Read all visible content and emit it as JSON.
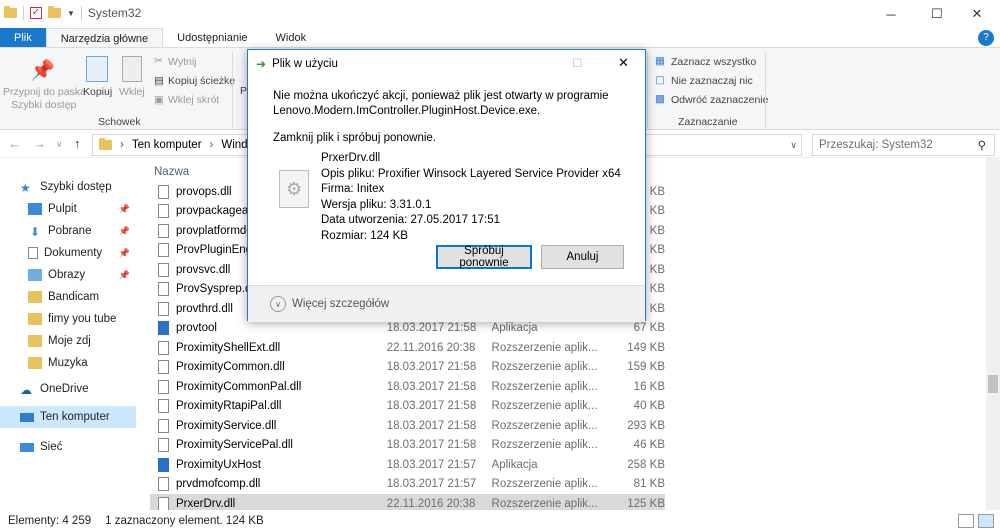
{
  "window": {
    "title": "System32",
    "controls": [
      "─",
      "☐",
      "✕"
    ]
  },
  "ribbon_tabs": [
    "Plik",
    "Narzędzia główne",
    "Udostępnianie",
    "Widok"
  ],
  "ribbon": {
    "pin_label_1": "Przypnij do paska",
    "pin_label_2": "Szybki dostęp",
    "copy": "Kopiuj",
    "paste": "Wklej",
    "cut": "Wytnij",
    "copy_path": "Kopiuj ścieżkę",
    "paste_shortcut": "Wklej skrót",
    "partial_p": "P",
    "group_clipboard": "Schowek",
    "select_all": "Zaznacz wszystko",
    "select_none": "Nie zaznaczaj nic",
    "invert": "Odwróć zaznaczenie",
    "group_select": "Zaznaczanie",
    "help": "?"
  },
  "address": {
    "parts": [
      "Ten komputer",
      "Window"
    ],
    "search_placeholder": "Przeszukaj: System32"
  },
  "nav": {
    "quick": "Szybki dostęp",
    "items": [
      "Pulpit",
      "Pobrane",
      "Dokumenty",
      "Obrazy",
      "Bandicam",
      "fimy you tube",
      "Moje zdj",
      "Muzyka"
    ],
    "onedrive": "OneDrive",
    "thispc": "Ten komputer",
    "network": "Sieć"
  },
  "list": {
    "header_name": "Nazwa",
    "rows": [
      {
        "name": "provops.dll",
        "date": "",
        "type": "",
        "size": "KB"
      },
      {
        "name": "provpackageap",
        "date": "",
        "type": "",
        "size": "KB"
      },
      {
        "name": "provplatformde",
        "date": "",
        "type": "",
        "size": "KB"
      },
      {
        "name": "ProvPluginEng.d",
        "date": "",
        "type": "",
        "size": "KB"
      },
      {
        "name": "provsvc.dll",
        "date": "",
        "type": "",
        "size": "KB"
      },
      {
        "name": "ProvSysprep.dll",
        "date": "",
        "type": "",
        "size": "KB"
      },
      {
        "name": "provthrd.dll",
        "date": "",
        "type": "",
        "size": "KB"
      },
      {
        "name": "provtool",
        "date": "18.03.2017 21:58",
        "type": "Aplikacja",
        "size": "67 KB"
      },
      {
        "name": "ProximityShellExt.dll",
        "date": "22.11.2016 20:38",
        "type": "Rozszerzenie aplik...",
        "size": "149 KB"
      },
      {
        "name": "ProximityCommon.dll",
        "date": "18.03.2017 21:58",
        "type": "Rozszerzenie aplik...",
        "size": "159 KB"
      },
      {
        "name": "ProximityCommonPal.dll",
        "date": "18.03.2017 21:58",
        "type": "Rozszerzenie aplik...",
        "size": "16 KB"
      },
      {
        "name": "ProximityRtapiPal.dll",
        "date": "18.03.2017 21:58",
        "type": "Rozszerzenie aplik...",
        "size": "40 KB"
      },
      {
        "name": "ProximityService.dll",
        "date": "18.03.2017 21:58",
        "type": "Rozszerzenie aplik...",
        "size": "293 KB"
      },
      {
        "name": "ProximityServicePal.dll",
        "date": "18.03.2017 21:58",
        "type": "Rozszerzenie aplik...",
        "size": "46 KB"
      },
      {
        "name": "ProximityUxHost",
        "date": "18.03.2017 21:57",
        "type": "Aplikacja",
        "size": "258 KB"
      },
      {
        "name": "prvdmofcomp.dll",
        "date": "18.03.2017 21:57",
        "type": "Rozszerzenie aplik...",
        "size": "81 KB"
      },
      {
        "name": "PrxerDrv.dll",
        "date": "22.11.2016 20:38",
        "type": "Rozszerzenie aplik...",
        "size": "125 KB"
      }
    ]
  },
  "status": {
    "count": "Elementy: 4 259",
    "selected": "1 zaznaczony element. 124 KB"
  },
  "dialog": {
    "title": "Plik w użyciu",
    "msg1": "Nie można ukończyć akcji, ponieważ plik jest otwarty w programie",
    "msg2": "Lenovo.Modern.ImController.PluginHost.Device.exe.",
    "msg3": "Zamknij plik i spróbuj ponownie.",
    "file": "PrxerDrv.dll",
    "desc": "Opis pliku: Proxifier Winsock Layered Service Provider x64",
    "company": "Firma: Initex",
    "version": "Wersja pliku: 3.31.0.1",
    "created": "Data utworzenia: 27.05.2017 17:51",
    "size": "Rozmiar: 124 KB",
    "retry": "Spróbuj ponownie",
    "cancel": "Anuluj",
    "more": "Więcej szczegółów"
  }
}
